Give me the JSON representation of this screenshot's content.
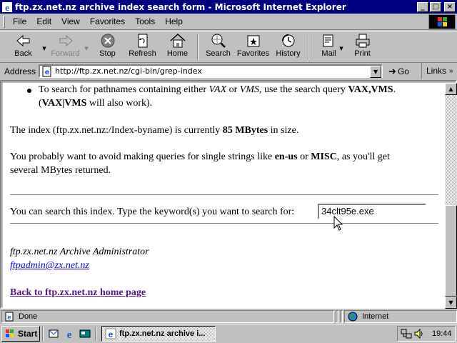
{
  "window": {
    "title": "ftp.zx.net.nz archive index search form - Microsoft Internet Explorer",
    "caption_buttons": {
      "minimize": "_",
      "maximize": "□",
      "close": "×"
    }
  },
  "menu": {
    "items": [
      "File",
      "Edit",
      "View",
      "Favorites",
      "Tools",
      "Help"
    ]
  },
  "toolbar": {
    "back": "Back",
    "forward": "Forward",
    "stop": "Stop",
    "refresh": "Refresh",
    "home": "Home",
    "search": "Search",
    "favorites": "Favorites",
    "history": "History",
    "mail": "Mail",
    "print": "Print"
  },
  "address": {
    "label": "Address",
    "url": "http://ftp.zx.net.nz/cgi-bin/grep-index",
    "go": "Go",
    "links": "Links"
  },
  "page": {
    "bullet": {
      "t1": "To search for pathnames containing either ",
      "em1": "VAX",
      "t2": " or ",
      "em2": "VMS",
      "t3": ", use the search query ",
      "b1": "VAX,VMS",
      "t4": ".",
      "t5": "(",
      "b2": "VAX|VMS",
      "t6": " will also work)."
    },
    "index": {
      "t1": "The index (ftp.zx.net.nz:/Index-byname) is currently ",
      "size": "85 MBytes",
      "t2": " in size."
    },
    "avoid": {
      "t1": "You probably want to avoid making queries for single strings like ",
      "b1": "en-us",
      "t2": " or ",
      "b2": "MISC",
      "t3": ", as you'll get",
      "t4": "several MBytes returned."
    },
    "search_prompt": "You can search this index. Type the keyword(s) you want to search for:",
    "search_value": "34clt95e.exe",
    "admin": "ftp.zx.net.nz Archive Administrator",
    "email": "ftpadmin@zx.net.nz",
    "back_link": "Back to ftp.zx.net.nz home page"
  },
  "status": {
    "text": "Done",
    "zone": "Internet"
  },
  "taskbar": {
    "start": "Start",
    "task": "ftp.zx.net.nz archive i...",
    "clock": "19:44"
  }
}
